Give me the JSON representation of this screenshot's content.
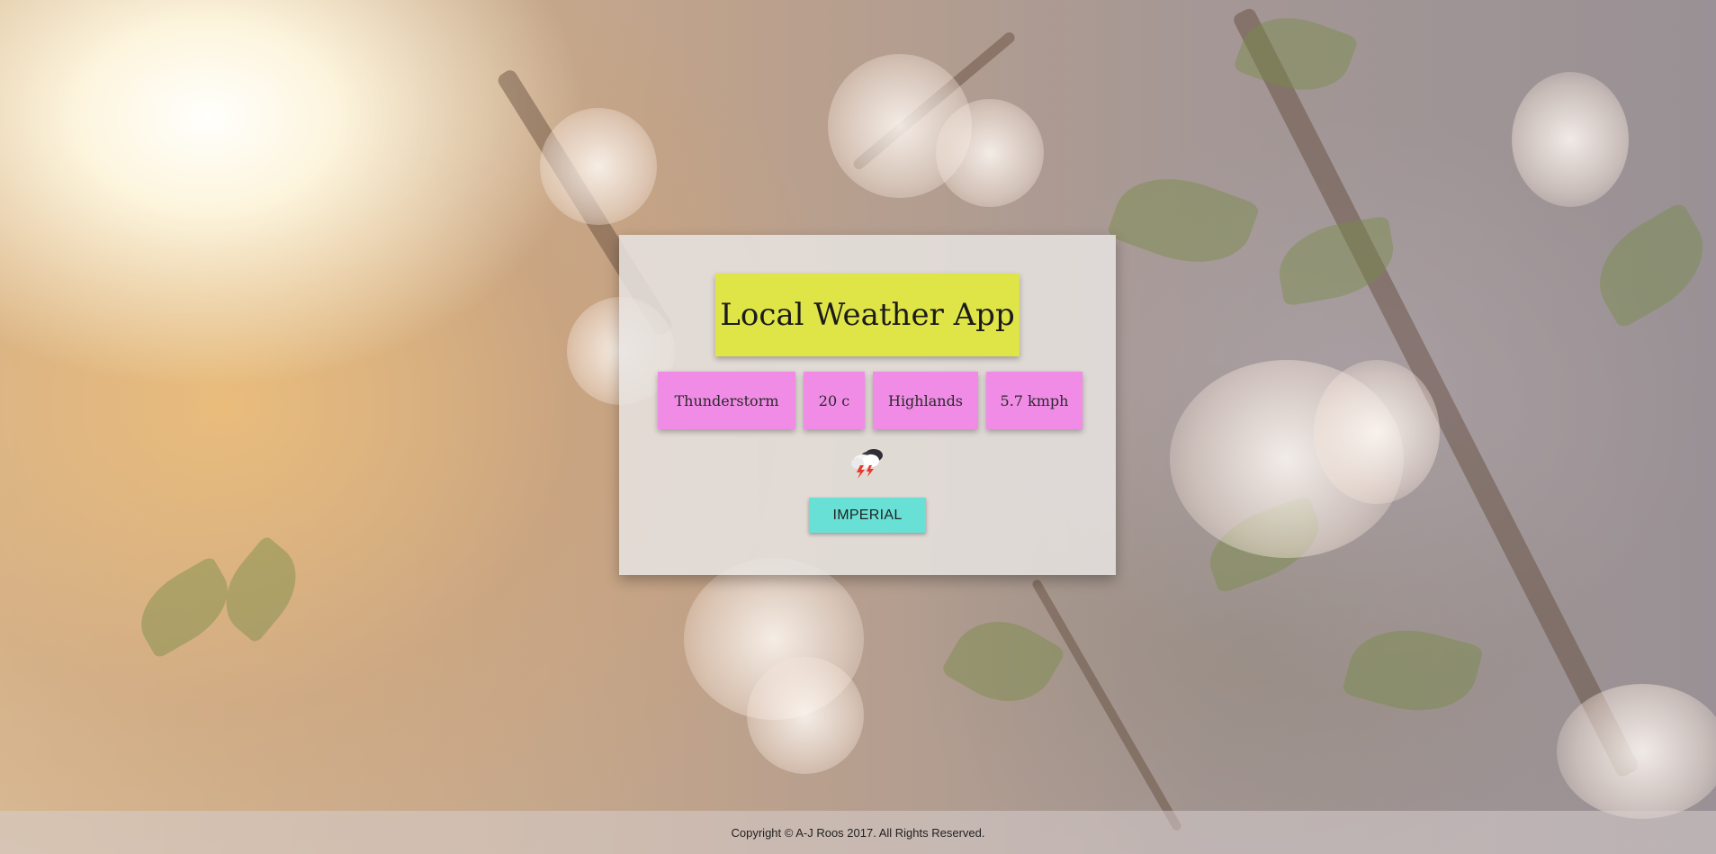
{
  "app": {
    "title": "Local Weather App"
  },
  "weather": {
    "condition": "Thunderstorm",
    "temperature": "20 c",
    "location": "Highlands",
    "wind_speed": "5.7 kmph",
    "icon": "thunderstorm-icon"
  },
  "controls": {
    "units_button_label": "IMPERIAL"
  },
  "footer": {
    "copyright": "Copyright © A-J Roos 2017. All Rights Reserved."
  },
  "colors": {
    "title_bg": "#dfe547",
    "stat_bg": "#f08be6",
    "button_bg": "#68e0d6",
    "card_bg": "rgba(232,228,226,0.85)"
  }
}
